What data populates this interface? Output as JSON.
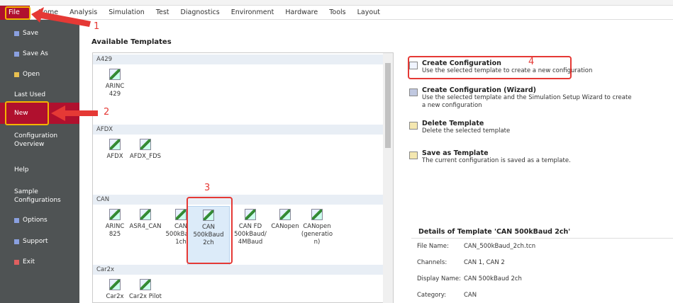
{
  "menu": [
    "File",
    "Home",
    "Analysis",
    "Simulation",
    "Test",
    "Diagnostics",
    "Environment",
    "Hardware",
    "Tools",
    "Layout"
  ],
  "sidebar": [
    {
      "label": "Save",
      "icon": "save-icon"
    },
    {
      "label": "Save As",
      "icon": "save-as-icon"
    },
    {
      "label": "Open",
      "icon": "folder-icon"
    },
    {
      "label": "Last Used"
    },
    {
      "label": "New"
    },
    {
      "label": "Configuration\nOverview"
    },
    {
      "label": "Help"
    },
    {
      "label": "Sample\nConfigurations"
    },
    {
      "label": "Options",
      "icon": "options-icon"
    },
    {
      "label": "Support",
      "icon": "support-icon"
    },
    {
      "label": "Exit",
      "icon": "exit-icon"
    }
  ],
  "main": {
    "title": "Available Templates",
    "groups": [
      {
        "name": "A429",
        "items": [
          "ARINC\n429"
        ]
      },
      {
        "name": "AFDX",
        "items": [
          "AFDX",
          "AFDX_FDS"
        ]
      },
      {
        "name": "CAN",
        "items": [
          "ARINC\n825",
          "ASR4_CAN",
          "CAN\n500kBaud\n1ch",
          "CAN\n500kBaud\n2ch",
          "CAN FD\n500kBaud/\n4MBaud",
          "CANopen",
          "CANopen\n(generatio\nn)"
        ]
      },
      {
        "name": "Car2x",
        "items": [
          "Car2x",
          "Car2x Pilot"
        ]
      }
    ],
    "selected": "CAN\n500kBaud\n2ch"
  },
  "actions": [
    {
      "title": "Create Configuration",
      "desc": "Use the selected template to create a new configuration"
    },
    {
      "title": "Create Configuration (Wizard)",
      "desc": "Use the selected template and the Simulation Setup Wizard to create a new configuration"
    },
    {
      "title": "Delete Template",
      "desc": "Delete the selected template"
    },
    {
      "title": "Save as Template",
      "desc": "The current configuration is saved as a template."
    }
  ],
  "details": {
    "title": "Details of Template 'CAN 500kBaud 2ch'",
    "rows": [
      {
        "label": "File Name:",
        "value": "CAN_500kBaud_2ch.tcn"
      },
      {
        "label": "Channels:",
        "value": "CAN 1, CAN 2"
      },
      {
        "label": "Display Name:",
        "value": "CAN 500kBaud 2ch"
      },
      {
        "label": "Category:",
        "value": "CAN"
      }
    ]
  },
  "annotations": [
    "1",
    "2",
    "3",
    "4"
  ],
  "colors": {
    "accent": "#b0102e",
    "sidebar": "#4f5354",
    "annotation": "#e53935",
    "highlight": "#f4b400"
  }
}
